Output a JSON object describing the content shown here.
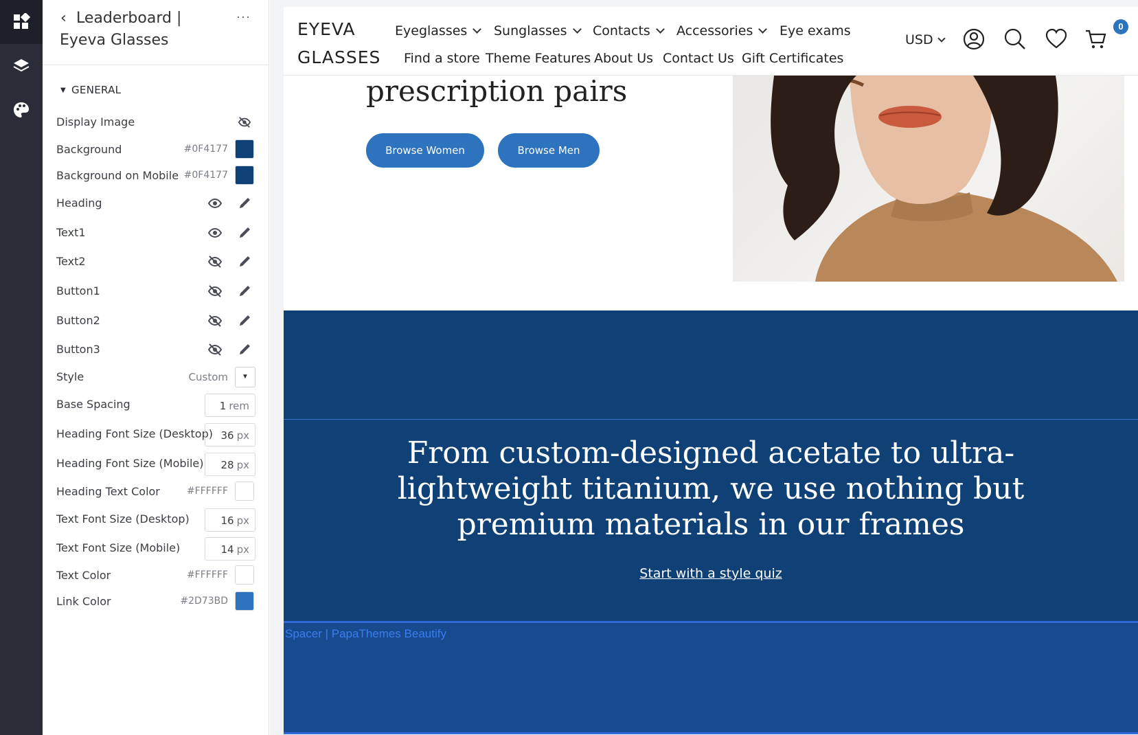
{
  "rail": {
    "items": [
      {
        "name": "sections-icon",
        "active": true
      },
      {
        "name": "layers-icon",
        "active": false
      },
      {
        "name": "palette-icon",
        "active": false
      }
    ]
  },
  "panel": {
    "title_line1": "Leaderboard |",
    "title_line2": "Eyeva Glasses",
    "back_icon": "chevron-left-icon",
    "more_label": "···",
    "section_title": "GENERAL",
    "rows": {
      "display_image": {
        "label": "Display Image",
        "icon": "eye-off-icon"
      },
      "background": {
        "label": "Background",
        "hex": "#0F4177",
        "color": "#0F4177"
      },
      "background_mobile": {
        "label": "Background on Mobile",
        "hex": "#0F4177",
        "color": "#0F4177"
      },
      "heading": {
        "label": "Heading",
        "visibility": "eye-icon",
        "edit": "pencil-icon"
      },
      "text1": {
        "label": "Text1",
        "visibility": "eye-icon",
        "edit": "pencil-icon"
      },
      "text2": {
        "label": "Text2",
        "visibility": "eye-off-icon",
        "edit": "pencil-icon"
      },
      "button1": {
        "label": "Button1",
        "visibility": "eye-off-icon",
        "edit": "pencil-icon"
      },
      "button2": {
        "label": "Button2",
        "visibility": "eye-off-icon",
        "edit": "pencil-icon"
      },
      "button3": {
        "label": "Button3",
        "visibility": "eye-off-icon",
        "edit": "pencil-icon"
      },
      "style": {
        "label": "Style",
        "value": "Custom"
      },
      "base_spacing": {
        "label": "Base Spacing",
        "value": "1",
        "unit": "rem"
      },
      "heading_size_desktop": {
        "label": "Heading Font Size (Desktop)",
        "value": "36",
        "unit": "px"
      },
      "heading_size_mobile": {
        "label": "Heading Font Size (Mobile)",
        "value": "28",
        "unit": "px"
      },
      "heading_text_color": {
        "label": "Heading Text Color",
        "hex": "#FFFFFF",
        "color": "#FFFFFF"
      },
      "text_size_desktop": {
        "label": "Text Font Size (Desktop)",
        "value": "16",
        "unit": "px"
      },
      "text_size_mobile": {
        "label": "Text Font Size (Mobile)",
        "value": "14",
        "unit": "px"
      },
      "text_color": {
        "label": "Text Color",
        "hex": "#FFFFFF",
        "color": "#FFFFFF"
      },
      "link_color": {
        "label": "Link Color",
        "hex": "#2D73BD",
        "color": "#2D73BD"
      }
    }
  },
  "site": {
    "logo_line1": "EYEVA",
    "logo_line2": "GLASSES",
    "nav_row1": [
      {
        "label": "Eyeglasses",
        "dropdown": true
      },
      {
        "label": "Sunglasses",
        "dropdown": true
      },
      {
        "label": "Contacts",
        "dropdown": true
      },
      {
        "label": "Accessories",
        "dropdown": true
      },
      {
        "label": "Eye exams",
        "dropdown": false
      }
    ],
    "nav_row2": [
      {
        "label": "Find a store"
      },
      {
        "label": "Theme Features"
      },
      {
        "label": "About Us"
      },
      {
        "label": "Contact Us"
      },
      {
        "label": "Gift Certificates"
      }
    ],
    "currency": "USD",
    "cart_count": "0",
    "header_icons": [
      "account-icon",
      "search-icon",
      "heart-icon",
      "cart-icon"
    ],
    "hero": {
      "heading": "prescription pairs",
      "button_women": "Browse Women",
      "button_men": "Browse Men",
      "button_color": "#2D73BD"
    },
    "leaderboard": {
      "heading": "From custom-designed acetate to ultra-lightweight titanium, we use nothing but premium materials in our frames",
      "link": "Start with a style quiz",
      "background": "#0F4177"
    },
    "spacer": {
      "label": "Spacer | PapaThemes Beautify"
    }
  }
}
